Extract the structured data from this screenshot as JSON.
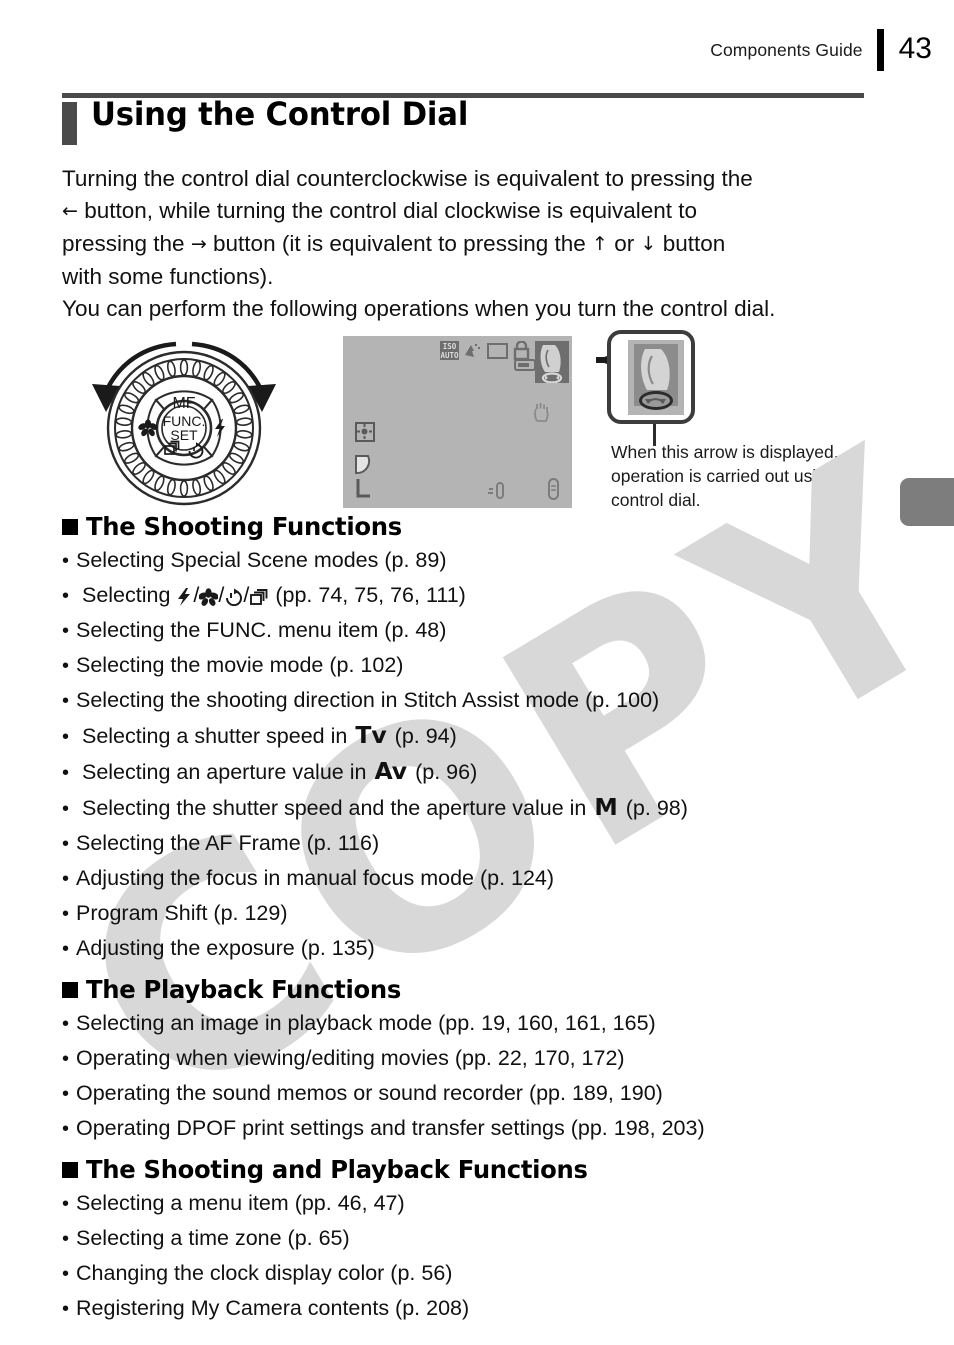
{
  "header": {
    "label": "Components Guide",
    "page_number": "43"
  },
  "title": "Using the Control Dial",
  "intro": {
    "line1": "Turning the control dial counterclockwise is equivalent to pressing the",
    "line2_arrow": "←",
    "line2": "button, while turning the control dial clockwise is equivalent to",
    "line3_pre": "pressing the",
    "line3_arrow": "→",
    "line3_mid": "button (it is equivalent to pressing the",
    "line3_arrow_up": "↑",
    "line3_or": "or",
    "line3_arrow_down": "↓",
    "line3_post": "button",
    "line4": "with some functions).",
    "line5": "You can perform the following operations when you turn the control dial."
  },
  "figure": {
    "dial": {
      "label_mf": "MF",
      "label_func": "FUNC.",
      "label_set": "SET",
      "icon_left": "macro-flower-icon",
      "icon_right": "flash-bolt-icon",
      "icon_bottom_left": "continuous-drive-icon",
      "icon_bottom_right": "self-timer-icon",
      "arrow_left": "counterclockwise-arrow",
      "arrow_right": "clockwise-arrow"
    },
    "lcd": {
      "iso_label_top": "ISO",
      "iso_label_bottom": "AUTO",
      "icons": [
        "iso-auto-icon",
        "white-balance-icon",
        "image-size-icon",
        "shooting-mode-icon",
        "battery-icon",
        "portrait-mode-icon",
        "camera-shake-warning-icon",
        "af-frame-icon",
        "image-quality-large-icon",
        "exposure-compensation-icon",
        "drive-mode-icon"
      ],
      "quality_label": "L"
    },
    "callout": {
      "line1": "When this arrow is displayed,",
      "line2": "operation is carried out using",
      "line3": "control dial."
    }
  },
  "sections": [
    {
      "heading": "The Shooting Functions",
      "items": [
        {
          "text": "Selecting Special Scene modes (p. 89)"
        },
        {
          "pre": "Selecting",
          "icons": [
            "flash-bolt-icon",
            "macro-flower-icon",
            "self-timer-icon",
            "continuous-drive-icon"
          ],
          "post": "(pp. 74, 75, 76, 111)"
        },
        {
          "text": "Selecting the FUNC. menu item (p. 48)"
        },
        {
          "text": "Selecting the movie mode (p. 102)"
        },
        {
          "text": "Selecting the shooting direction in Stitch Assist mode (p. 100)"
        },
        {
          "pre": "Selecting a shutter speed in",
          "mode": "Tv",
          "post": "(p. 94)"
        },
        {
          "pre": "Selecting an aperture value in",
          "mode": "Av",
          "post": "(p. 96)"
        },
        {
          "pre": "Selecting the shutter speed and the aperture value in",
          "mode": "M",
          "post": "(p. 98)"
        },
        {
          "text": "Selecting the AF Frame (p. 116)"
        },
        {
          "text": "Adjusting the focus in manual focus mode (p. 124)"
        },
        {
          "text": "Program Shift (p. 129)"
        },
        {
          "text": "Adjusting the exposure (p. 135)"
        }
      ]
    },
    {
      "heading": "The Playback Functions",
      "items": [
        {
          "text": "Selecting an image in playback mode (pp. 19, 160, 161, 165)"
        },
        {
          "text": "Operating when viewing/editing movies (pp. 22, 170, 172)"
        },
        {
          "text": "Operating the sound memos or sound recorder (pp. 189, 190)"
        },
        {
          "text": "Operating DPOF print settings and transfer settings (pp. 198, 203)"
        }
      ]
    },
    {
      "heading": "The Shooting and Playback Functions",
      "items": [
        {
          "text": "Selecting a menu item (pp. 46, 47)"
        },
        {
          "text": "Selecting a time zone (p. 65)"
        },
        {
          "text": "Changing the clock display color (p. 56)"
        },
        {
          "text": "Registering My Camera contents (p. 208)"
        }
      ]
    }
  ],
  "watermark": {
    "text": "COPY"
  },
  "bullet_char": "•",
  "colors": {
    "title_bar": "#4a4a4a",
    "lcd_background": "#b4b4b4",
    "lcd_icon": "#6e6e6e",
    "side_tab": "#7d7d7d",
    "watermark": "#d8d8d8"
  }
}
